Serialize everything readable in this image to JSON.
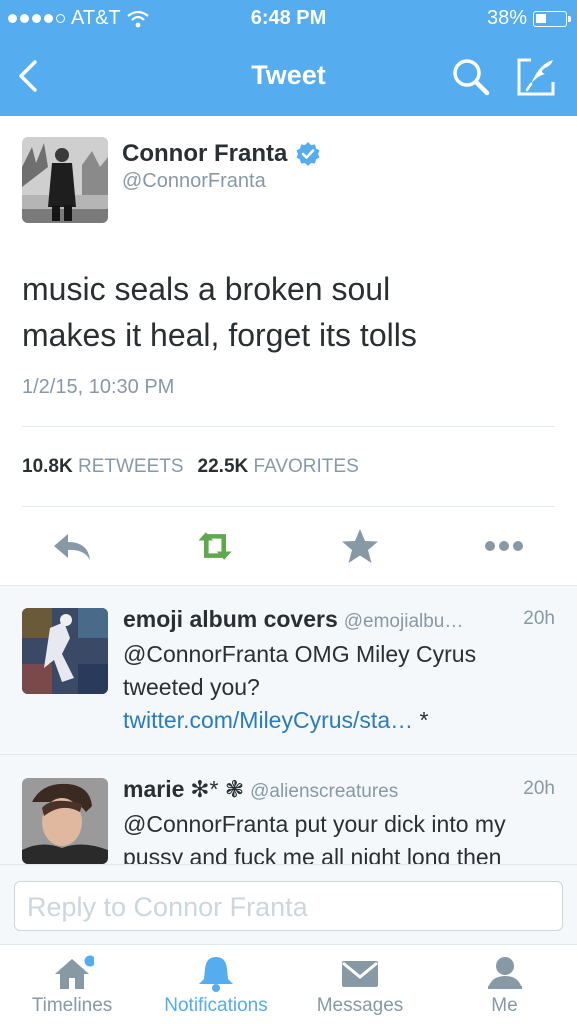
{
  "status_bar": {
    "carrier": "AT&T",
    "time": "6:48 PM",
    "battery_percent": "38%",
    "battery_level": 0.38,
    "signal_bars": 4
  },
  "nav": {
    "title": "Tweet",
    "back_icon": "chevron-left-icon",
    "search_icon": "search-icon",
    "compose_icon": "compose-icon"
  },
  "tweet": {
    "author_name": "Connor Franta",
    "author_handle": "@ConnorFranta",
    "verified": true,
    "text_line1": "music seals a broken soul",
    "text_line2": "makes it heal, forget its tolls",
    "timestamp": "1/2/15, 10:30 PM",
    "retweets_count": "10.8K",
    "retweets_label": "RETWEETS",
    "favorites_count": "22.5K",
    "favorites_label": "FAVORITES"
  },
  "actions": {
    "reply_icon": "reply-icon",
    "retweet_icon": "retweet-icon",
    "favorite_icon": "star-icon",
    "more_icon": "more-icon"
  },
  "replies": [
    {
      "name": "emoji album covers",
      "handle": "@emojialbu…",
      "time": "20h",
      "text_prefix": "@ConnorFranta OMG Miley Cyrus tweeted you? ",
      "link": "twitter.com/MileyCyrus/sta…",
      "text_suffix": " *"
    },
    {
      "name": "marie",
      "name_symbols": "✻* ❃",
      "handle": "@alienscreatures",
      "time": "20h",
      "text": "@ConnorFranta put your dick into my pussy and fuck me all night long then"
    }
  ],
  "reply_box": {
    "placeholder": "Reply to Connor Franta"
  },
  "tabs": [
    {
      "label": "Timelines",
      "icon": "home-icon",
      "active": false,
      "badge": true
    },
    {
      "label": "Notifications",
      "icon": "bell-icon",
      "active": true
    },
    {
      "label": "Messages",
      "icon": "envelope-icon",
      "active": false
    },
    {
      "label": "Me",
      "icon": "person-icon",
      "active": false
    }
  ],
  "colors": {
    "brand_blue": "#55acee",
    "retweet_green": "#5fa84f",
    "muted_gray": "#8899a6",
    "link_blue": "#2b7bb9"
  }
}
